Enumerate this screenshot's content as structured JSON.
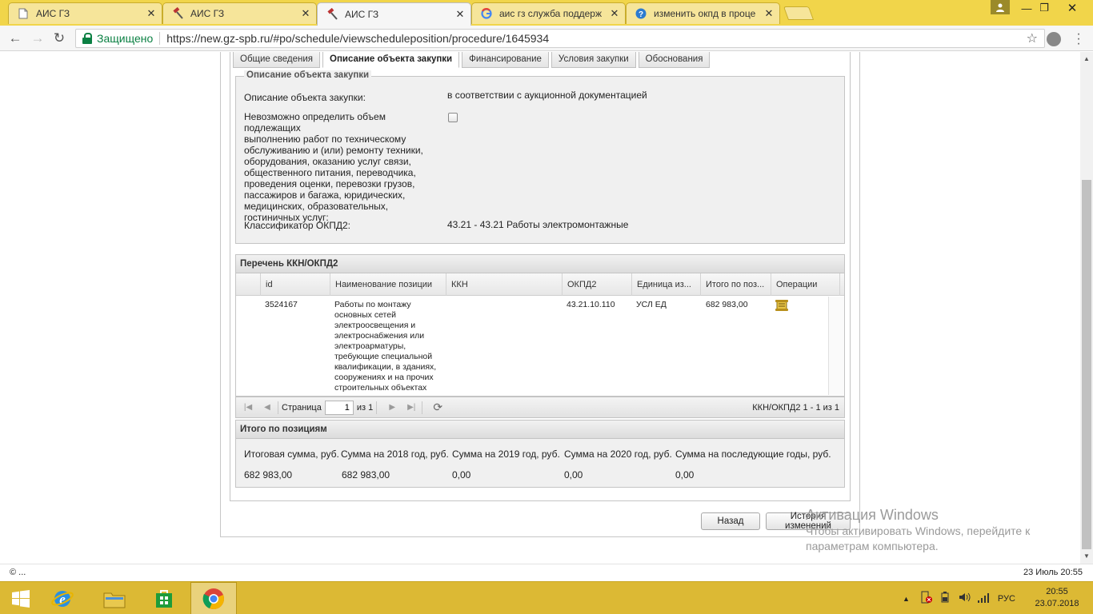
{
  "browser": {
    "tabs": [
      {
        "title": "АИС ГЗ",
        "icon": "document-icon",
        "active": false
      },
      {
        "title": "АИС ГЗ",
        "icon": "gavel-icon",
        "active": false
      },
      {
        "title": "АИС ГЗ",
        "icon": "gavel-icon",
        "active": true
      },
      {
        "title": "аис гз служба поддерж",
        "icon": "google-icon",
        "active": false
      },
      {
        "title": "изменить окпд в проце",
        "icon": "help-icon",
        "active": false
      }
    ],
    "secure_label": "Защищено",
    "url": "https://new.gz-spb.ru/#po/schedule/viewscheduleposition/procedure/1645934"
  },
  "page": {
    "tabs": [
      {
        "label": "Общие сведения"
      },
      {
        "label": "Описание объекта закупки"
      },
      {
        "label": "Финансирование"
      },
      {
        "label": "Условия закупки"
      },
      {
        "label": "Обоснования"
      }
    ],
    "description": {
      "legend": "Описание объекта закупки",
      "object_label": "Описание объекта закупки:",
      "object_value": "в соответствии с аукционной документацией",
      "volume_label_lines": [
        "Невозможно определить объем подлежащих",
        "выполнению работ по техническому",
        "обслуживанию и (или) ремонту техники,",
        "оборудования, оказанию услуг связи,",
        "общественного питания, переводчика,",
        "проведения оценки, перевозки грузов,",
        "пассажиров и багажа, юридических,",
        "медицинских, образовательных,",
        "гостиничных услуг:"
      ],
      "volume_checked": false,
      "okpd_label": "Классификатор ОКПД2:",
      "okpd_value": "43.21 - 43.21 Работы электромонтажные"
    },
    "kkn_section": {
      "title": "Перечень ККН/ОКПД2",
      "columns": [
        "id",
        "Наименование позиции",
        "ККН",
        "ОКПД2",
        "Единица из...",
        "Итого по поз...",
        "Операции"
      ],
      "rows": [
        {
          "id": "3524167",
          "name_lines": [
            "Работы по монтажу",
            "основных сетей",
            "электроосвещения и",
            "электроснабжения или",
            "электроарматуры,",
            "требующие специальной",
            "квалификации, в зданиях,",
            "сооружениях и на прочих",
            "строительных объектах"
          ],
          "kkn": "",
          "okpd2": "43.21.10.110",
          "unit": "УСЛ ЕД",
          "total": "682 983,00",
          "operation_icon": "scroll-icon"
        }
      ],
      "pager": {
        "page_label": "Страница",
        "page_value": "1",
        "of_label": "из 1",
        "info": "ККН/ОКПД2 1 - 1 из 1"
      }
    },
    "totals": {
      "title": "Итого по позициям",
      "labels": [
        "Итоговая сумма, руб.",
        "Сумма на 2018 год, руб.",
        "Сумма на 2019 год, руб.",
        "Сумма на 2020 год, руб.",
        "Сумма на последующие годы, руб."
      ],
      "values": [
        "682 983,00",
        "682 983,00",
        "0,00",
        "0,00",
        "0,00"
      ]
    },
    "buttons": {
      "back": "Назад",
      "history": "История изменений"
    }
  },
  "activation": {
    "title": "Активация Windows",
    "text": "Чтобы активировать Windows, перейдите к параметрам компьютера."
  },
  "statusbar": {
    "left": "© ...",
    "right": "23 Июль 20:55"
  },
  "taskbar": {
    "language": "РУС",
    "time": "20:55",
    "date": "23.07.2018"
  },
  "colors": {
    "taskbar": "#dcb934",
    "tabstrip": "#f1d54a",
    "secure": "#0b8043"
  }
}
